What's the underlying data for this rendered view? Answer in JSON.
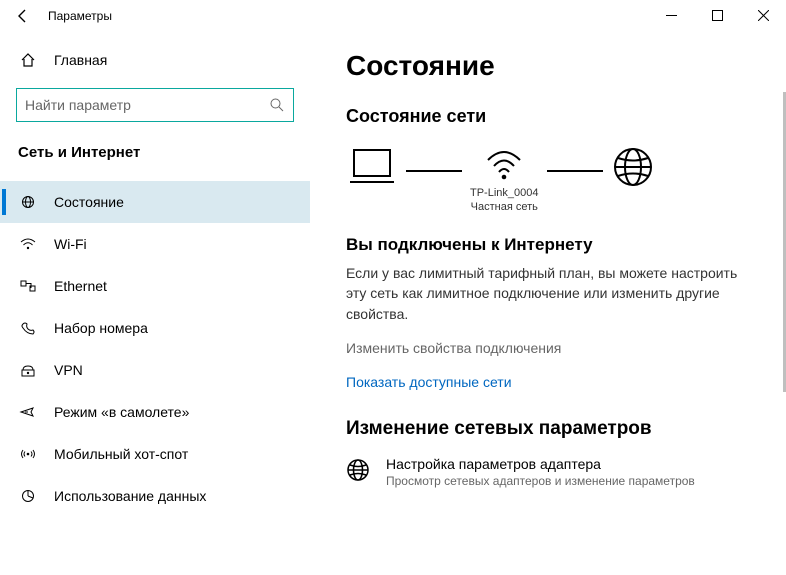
{
  "window": {
    "title": "Параметры"
  },
  "home_label": "Главная",
  "search": {
    "placeholder": "Найти параметр"
  },
  "section_title": "Сеть и Интернет",
  "nav": [
    {
      "label": "Состояние",
      "active": true
    },
    {
      "label": "Wi-Fi"
    },
    {
      "label": "Ethernet"
    },
    {
      "label": "Набор номера"
    },
    {
      "label": "VPN"
    },
    {
      "label": "Режим «в самолете»"
    },
    {
      "label": "Мобильный хот-спот"
    },
    {
      "label": "Использование данных"
    }
  ],
  "content": {
    "page_title": "Состояние",
    "status_title": "Состояние сети",
    "diagram": {
      "ssid": "TP-Link_0004",
      "nettype": "Частная сеть"
    },
    "connected_heading": "Вы подключены к Интернету",
    "connected_body": "Если у вас лимитный тарифный план, вы можете настроить эту сеть как лимитное подключение или изменить другие свойства.",
    "link_props": "Изменить свойства подключения",
    "link_available": "Показать доступные сети",
    "change_title": "Изменение сетевых параметров",
    "adapter": {
      "title": "Настройка параметров адаптера",
      "desc": "Просмотр сетевых адаптеров и изменение параметров"
    }
  }
}
